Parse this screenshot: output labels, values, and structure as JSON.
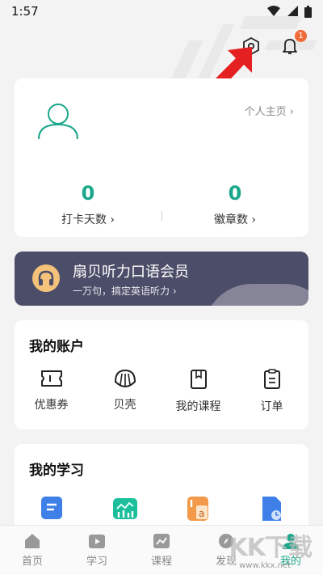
{
  "status_bar": {
    "time": "1:57"
  },
  "header": {
    "notification_count": "1"
  },
  "profile": {
    "homepage_label": "个人主页",
    "stats": [
      {
        "value": "0",
        "label": "打卡天数"
      },
      {
        "value": "0",
        "label": "徽章数"
      }
    ]
  },
  "vip": {
    "title": "扇贝听力口语会员",
    "subtitle": "一万句，搞定英语听力"
  },
  "account": {
    "title": "我的账户",
    "items": [
      {
        "label": "优惠券",
        "icon": "ticket-icon"
      },
      {
        "label": "贝壳",
        "icon": "shell-icon"
      },
      {
        "label": "我的课程",
        "icon": "book-icon"
      },
      {
        "label": "订单",
        "icon": "clipboard-icon"
      }
    ]
  },
  "study": {
    "title": "我的学习"
  },
  "tabs": [
    {
      "label": "首页",
      "icon": "home-icon"
    },
    {
      "label": "学习",
      "icon": "play-icon"
    },
    {
      "label": "课程",
      "icon": "chart-icon"
    },
    {
      "label": "发现",
      "icon": "compass-icon"
    },
    {
      "label": "我的",
      "icon": "person-icon",
      "active": true
    }
  ],
  "colors": {
    "accent": "#1aa68a",
    "vip_bg": "#4c4d68",
    "badge": "#f06a3a",
    "arrow": "#e52020"
  }
}
